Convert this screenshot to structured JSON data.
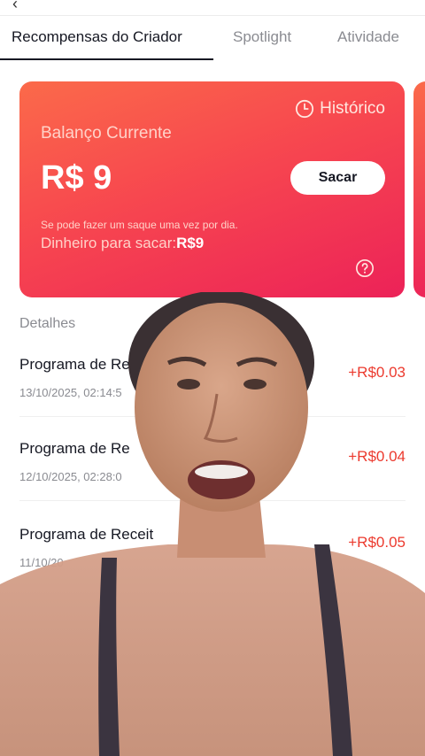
{
  "tabs": [
    {
      "label": "Recompensas do Criador",
      "active": true
    },
    {
      "label": "Spotlight",
      "active": false
    },
    {
      "label": "Atividade",
      "active": false
    }
  ],
  "balance_card": {
    "history_label": "Histórico",
    "balance_label": "Balanço Currente",
    "balance_value": "R$ 9",
    "withdraw_button": "Sacar",
    "note": "Se pode fazer um saque uma vez por dia.",
    "available_label": "Dinheiro para sacar:",
    "available_amount": "R$9"
  },
  "details": {
    "title": "Detalhes",
    "items": [
      {
        "name": "Programa de Recei",
        "date": "13/10/2025, 02:14:5",
        "amount": "+R$0.03"
      },
      {
        "name": "Programa de Re",
        "date": "12/10/2025, 02:28:0",
        "amount": "+R$0.04"
      },
      {
        "name": "Programa de Receit",
        "date": "11/10/20",
        "amount": "+R$0.05"
      }
    ]
  },
  "colors": {
    "card_gradient_start": "#fb6a4a",
    "card_gradient_end": "#ec2258",
    "amount_positive": "#ec3a2e",
    "tab_active": "#161823",
    "tab_inactive": "#8a8b91"
  }
}
